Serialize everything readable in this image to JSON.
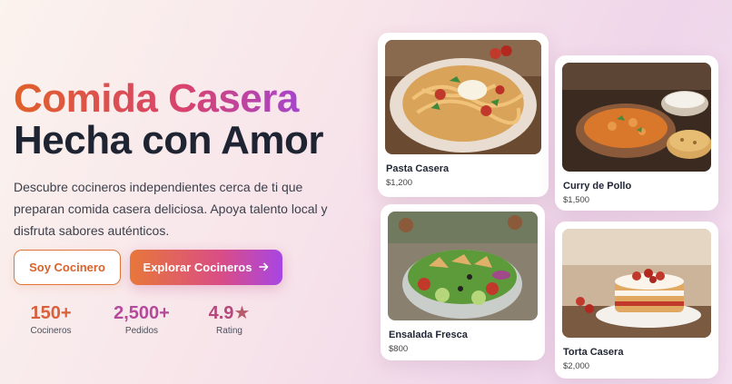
{
  "hero": {
    "title_line1": "Comida Casera",
    "title_line2": "Hecha con Amor",
    "description": "Descubre cocineros independientes cerca de ti que preparan comida casera deliciosa. Apoya talento local y disfruta sabores auténticos.",
    "primary_button": "Soy Cocinero",
    "secondary_button": "Explorar Cocineros",
    "secondary_button_icon": "arrow-right-icon"
  },
  "stats": [
    {
      "value": "150+",
      "label": "Cocineros"
    },
    {
      "value": "2,500+",
      "label": "Pedidos"
    },
    {
      "value": "4.9",
      "label": "Rating",
      "icon": "star-icon"
    }
  ],
  "dishes": [
    {
      "name": "Pasta Casera",
      "price": "$1,200"
    },
    {
      "name": "Curry de Pollo",
      "price": "$1,500"
    },
    {
      "name": "Ensalada Fresca",
      "price": "$800"
    },
    {
      "name": "Torta Casera",
      "price": "$2,000"
    }
  ],
  "colors": {
    "accent_orange": "#e0612a",
    "accent_pink": "#d8436e",
    "accent_purple": "#9b45e0",
    "text_dark": "#1f2433"
  }
}
